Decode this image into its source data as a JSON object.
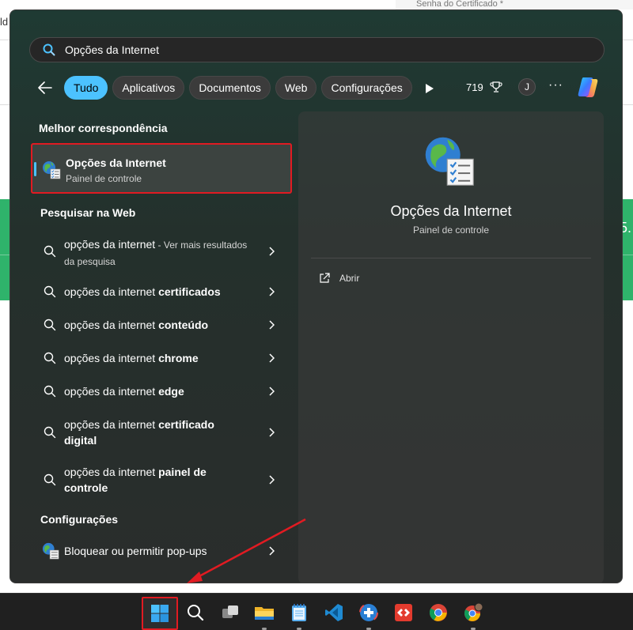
{
  "background": {
    "top_strip_text": "Senha do Certificado *",
    "left_glyph": "ld",
    "green_text": "5."
  },
  "search": {
    "value": "Opções da Internet"
  },
  "filters": {
    "chips": [
      "Tudo",
      "Aplicativos",
      "Documentos",
      "Web",
      "Configurações"
    ],
    "active": "Tudo",
    "points": "719",
    "avatar_initial": "J",
    "more_label": "···"
  },
  "best_match": {
    "heading": "Melhor correspondência",
    "title": "Opções da Internet",
    "subtitle": "Painel de controle"
  },
  "web_search": {
    "heading": "Pesquisar na Web",
    "results": [
      {
        "prefix": "opções da internet",
        "bold": "",
        "suffix": " - Ver mais resultados da pesquisa"
      },
      {
        "prefix": "opções da internet ",
        "bold": "certificados",
        "suffix": ""
      },
      {
        "prefix": "opções da internet ",
        "bold": "conteúdo",
        "suffix": ""
      },
      {
        "prefix": "opções da internet ",
        "bold": "chrome",
        "suffix": ""
      },
      {
        "prefix": "opções da internet ",
        "bold": "edge",
        "suffix": ""
      },
      {
        "prefix": "opções da internet ",
        "bold": "certificado digital",
        "suffix": ""
      },
      {
        "prefix": "opções da internet ",
        "bold": "painel de controle",
        "suffix": ""
      }
    ]
  },
  "settings": {
    "heading": "Configurações",
    "item": "Bloquear ou permitir pop-ups"
  },
  "preview": {
    "title": "Opções da Internet",
    "subtitle": "Painel de controle",
    "action_open": "Abrir"
  },
  "taskbar": {
    "icons": [
      "windows-start-icon",
      "search-icon",
      "task-view-icon",
      "file-explorer-icon",
      "notepad-icon",
      "vscode-icon",
      "app-plus-icon",
      "anydesk-icon",
      "chrome-icon",
      "chrome-profile-icon"
    ]
  },
  "colors": {
    "accent": "#4cc2ff",
    "highlight_border": "#e11b22",
    "taskbar": "#202020"
  }
}
